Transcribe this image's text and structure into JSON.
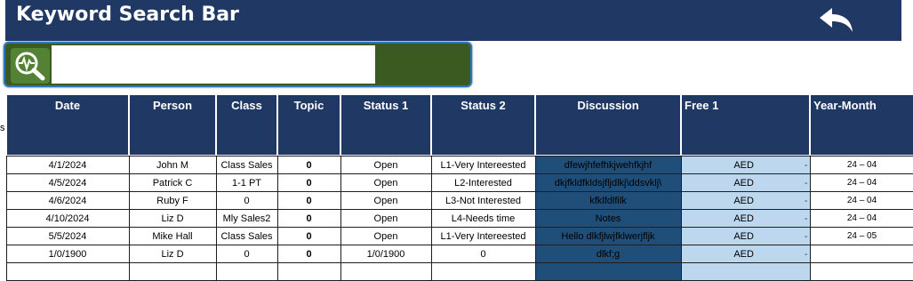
{
  "header": {
    "title": "Keyword Search Bar",
    "back_icon": "undo-arrow-icon"
  },
  "search": {
    "value": "",
    "icon": "magnifier-pulse-icon"
  },
  "left_stub": "s",
  "columns": [
    "Date",
    "Person",
    "Class",
    "Topic",
    "Status 1",
    "Status 2",
    "Discussion",
    "Free 1",
    "Year-Month"
  ],
  "rows": [
    {
      "date": "4/1/2024",
      "person": "John M",
      "class": "Class Sales",
      "topic": "0",
      "status1": "Open",
      "status2": "L1-Very Intereested",
      "discussion": "dfewjhfefhkjwehfkjhf",
      "free1": "AED",
      "free1_dash": "-",
      "ym": "24 – 04"
    },
    {
      "date": "4/5/2024",
      "person": "Patrick C",
      "class": "1-1 PT",
      "topic": "0",
      "status1": "Open",
      "status2": "L2-Interested",
      "discussion": "dkjfkldfkldsjfljdlkj\\ddsvklj\\",
      "free1": "AED",
      "free1_dash": "-",
      "ym": "24 – 04"
    },
    {
      "date": "4/6/2024",
      "person": "Ruby F",
      "class": "0",
      "topic": "0",
      "status1": "Open",
      "status2": "L3-Not Interested",
      "discussion": "kfklfdlfilk",
      "free1": "AED",
      "free1_dash": "-",
      "ym": "24 – 04"
    },
    {
      "date": "4/10/2024",
      "person": "Liz D",
      "class": "Mly Sales2",
      "topic": "0",
      "status1": "Open",
      "status2": "L4-Needs time",
      "discussion": "Notes",
      "free1": "AED",
      "free1_dash": "-",
      "ym": "24 – 04"
    },
    {
      "date": "5/5/2024",
      "person": "Mike Hall",
      "class": "Class Sales",
      "topic": "0",
      "status1": "Open",
      "status2": "L1-Very Intereested",
      "discussion": "Hello dlkfjlwjfklwerjfljk",
      "free1": "AED",
      "free1_dash": "-",
      "ym": "24 – 05"
    },
    {
      "date": "1/0/1900",
      "person": "Liz D",
      "class": "0",
      "topic": "0",
      "status1": "1/0/1900",
      "status2": "0",
      "discussion": "dlkf;g",
      "free1": "AED",
      "free1_dash": "-",
      "ym": ""
    },
    {
      "date": "",
      "person": "",
      "class": "",
      "topic": "",
      "status1": "",
      "status2": "",
      "discussion": "",
      "free1": "",
      "free1_dash": "",
      "ym": ""
    }
  ],
  "colors": {
    "header_bg": "#1f3864",
    "search_green": "#3a5a22",
    "discussion_bg": "#1f4e79",
    "free_bg": "#bdd7ee",
    "zero_green": "#548235"
  }
}
